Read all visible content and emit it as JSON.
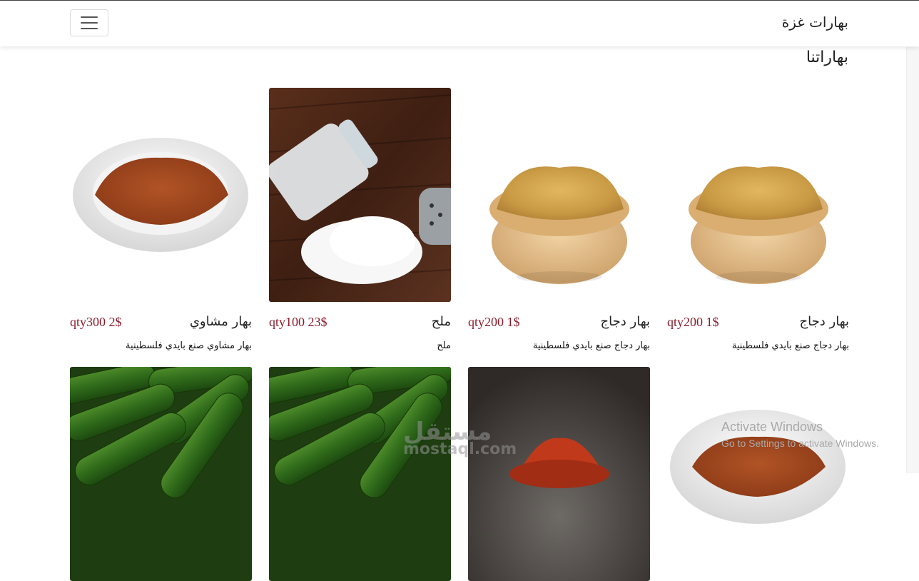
{
  "navbar": {
    "brand": "بهارات غزة",
    "menu_icon": "hamburger-icon"
  },
  "section": {
    "title": "بهاراتنا"
  },
  "products_row1": [
    {
      "name": "بهار دجاج",
      "price": "qty200 1$",
      "desc": "بهار دجاج صنع بايدي فلسطينية",
      "image": "spice-bowl"
    },
    {
      "name": "بهار دجاج",
      "price": "qty200 1$",
      "desc": "بهار دجاج صنع بايدي فلسطينية",
      "image": "spice-bowl"
    },
    {
      "name": "ملح",
      "price": "qty100 23$",
      "desc": "ملح",
      "image": "salt"
    },
    {
      "name": "بهار مشاوي",
      "price": "qty300 2$",
      "desc": "بهار مشاوي صنع بايدي فلسطينية",
      "image": "spice-plate"
    }
  ],
  "products_row2": [
    {
      "image": "spice-plate"
    },
    {
      "image": "paprika"
    },
    {
      "image": "cucumbers"
    },
    {
      "image": "cucumbers"
    }
  ],
  "overlays": {
    "activate_title": "Activate Windows",
    "activate_sub": "Go to Settings to activate Windows.",
    "watermark_ar": "مستقل",
    "watermark_lat": "mostaql.com"
  },
  "colors": {
    "price": "#8b1c2c",
    "text": "#222222"
  }
}
